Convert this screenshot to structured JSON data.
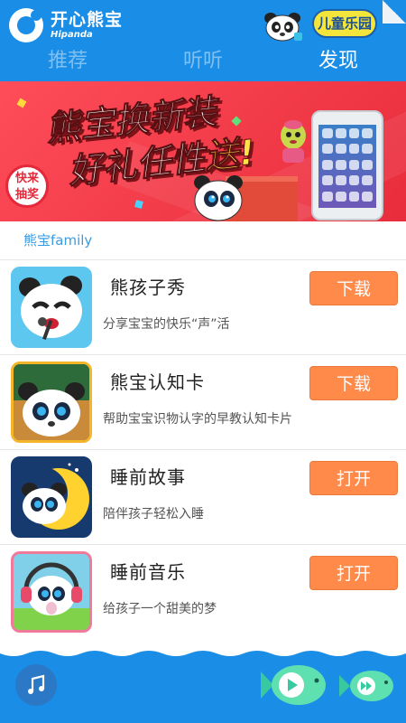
{
  "header": {
    "brand_cn": "开心熊宝",
    "brand_en": "Hipanda",
    "kids_button": "儿童乐园"
  },
  "tabs": [
    {
      "label": "推荐",
      "active": false
    },
    {
      "label": "听听",
      "active": false
    },
    {
      "label": "发现",
      "active": true
    }
  ],
  "banner": {
    "line1": "熊宝换新装",
    "line2_prefix": "好礼任性",
    "line2_highlight": "送!",
    "badge_line1": "快来",
    "badge_line2": "抽奖"
  },
  "section": {
    "title": "熊宝family"
  },
  "apps": [
    {
      "name": "熊孩子秀",
      "desc": "分享宝宝的快乐“声”活",
      "button": "下载",
      "icon": "panda-singer-icon"
    },
    {
      "name": "熊宝认知卡",
      "desc": "帮助宝宝识物认字的早教认知卡片",
      "button": "下载",
      "icon": "panda-chalkboard-icon"
    },
    {
      "name": "睡前故事",
      "desc": "陪伴孩子轻松入睡",
      "button": "打开",
      "icon": "panda-moon-icon"
    },
    {
      "name": "睡前音乐",
      "desc": "给孩子一个甜美的梦",
      "button": "打开",
      "icon": "panda-headphones-icon"
    }
  ],
  "bottom": {
    "music_icon": "music-note-icon",
    "play_icon": "fish-play-icon",
    "forward_icon": "fish-fast-forward-icon"
  },
  "colors": {
    "primary": "#1a8de6",
    "accent_button": "#ff8a4a",
    "section_title": "#3a9be0",
    "banner_red": "#f23b49"
  }
}
